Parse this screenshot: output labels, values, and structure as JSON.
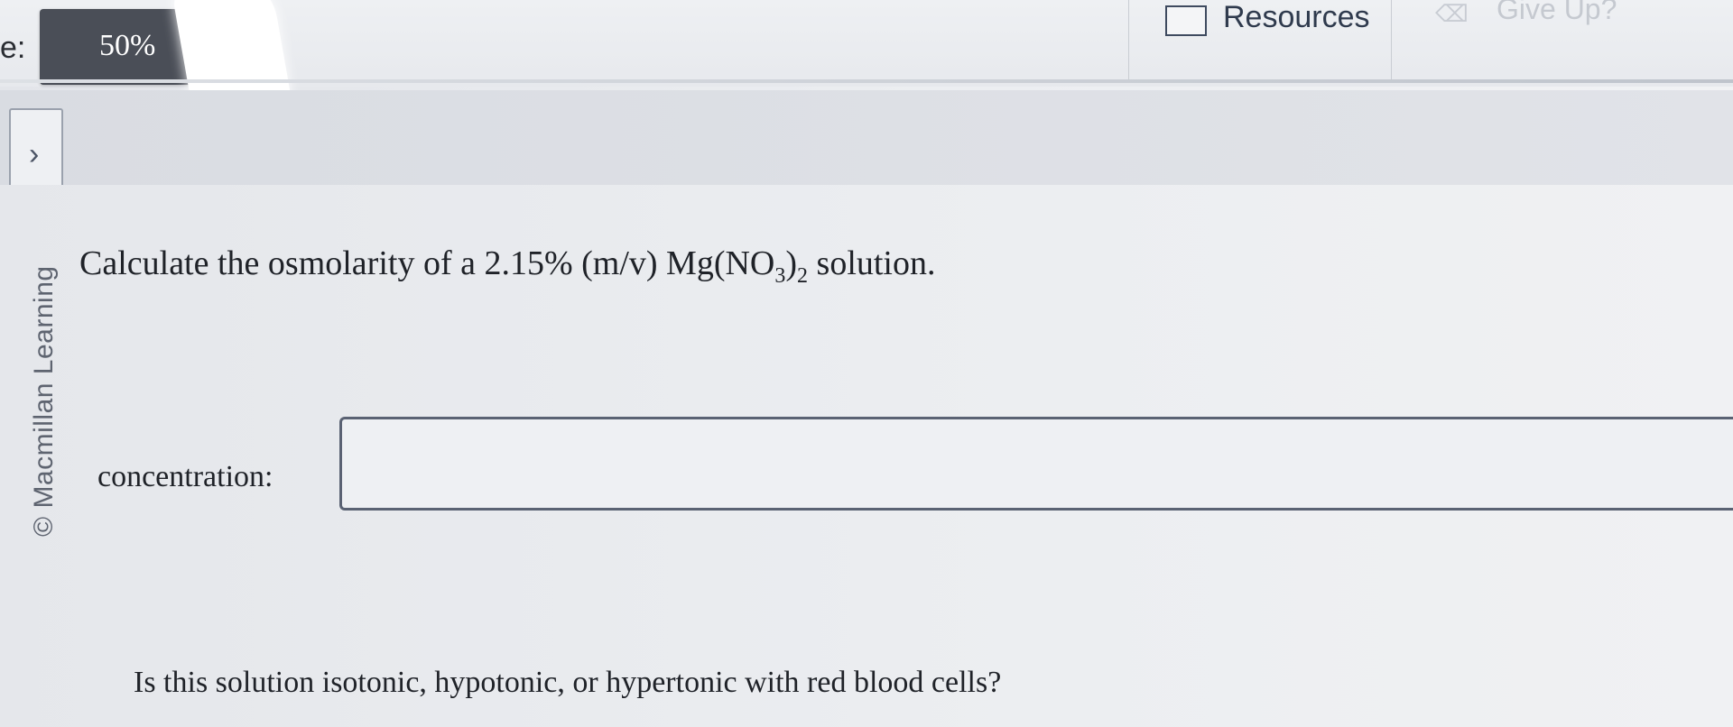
{
  "topbar": {
    "score_label": "e:",
    "score_value": "50%",
    "resources_label": "Resources",
    "giveup_label": "Give Up?"
  },
  "sidebar": {
    "expand_chevron": "›",
    "watermark": "© Macmillan Learning"
  },
  "question": {
    "prefix": "Calculate the osmolarity of a 2.15% (m/v) Mg(NO",
    "sub1": "3",
    "mid": ")",
    "sub2": "2",
    "suffix": " solution."
  },
  "answer": {
    "label": "concentration:",
    "value": ""
  },
  "followup": {
    "text": "Is this solution isotonic, hypotonic, or hypertonic with red blood cells?"
  },
  "icons": {
    "resources": "checkbox-icon",
    "giveup": "give-up-icon",
    "expand": "chevron-right-icon"
  },
  "colors": {
    "score_badge": "#4a4e57",
    "input_border": "#5a6273"
  }
}
